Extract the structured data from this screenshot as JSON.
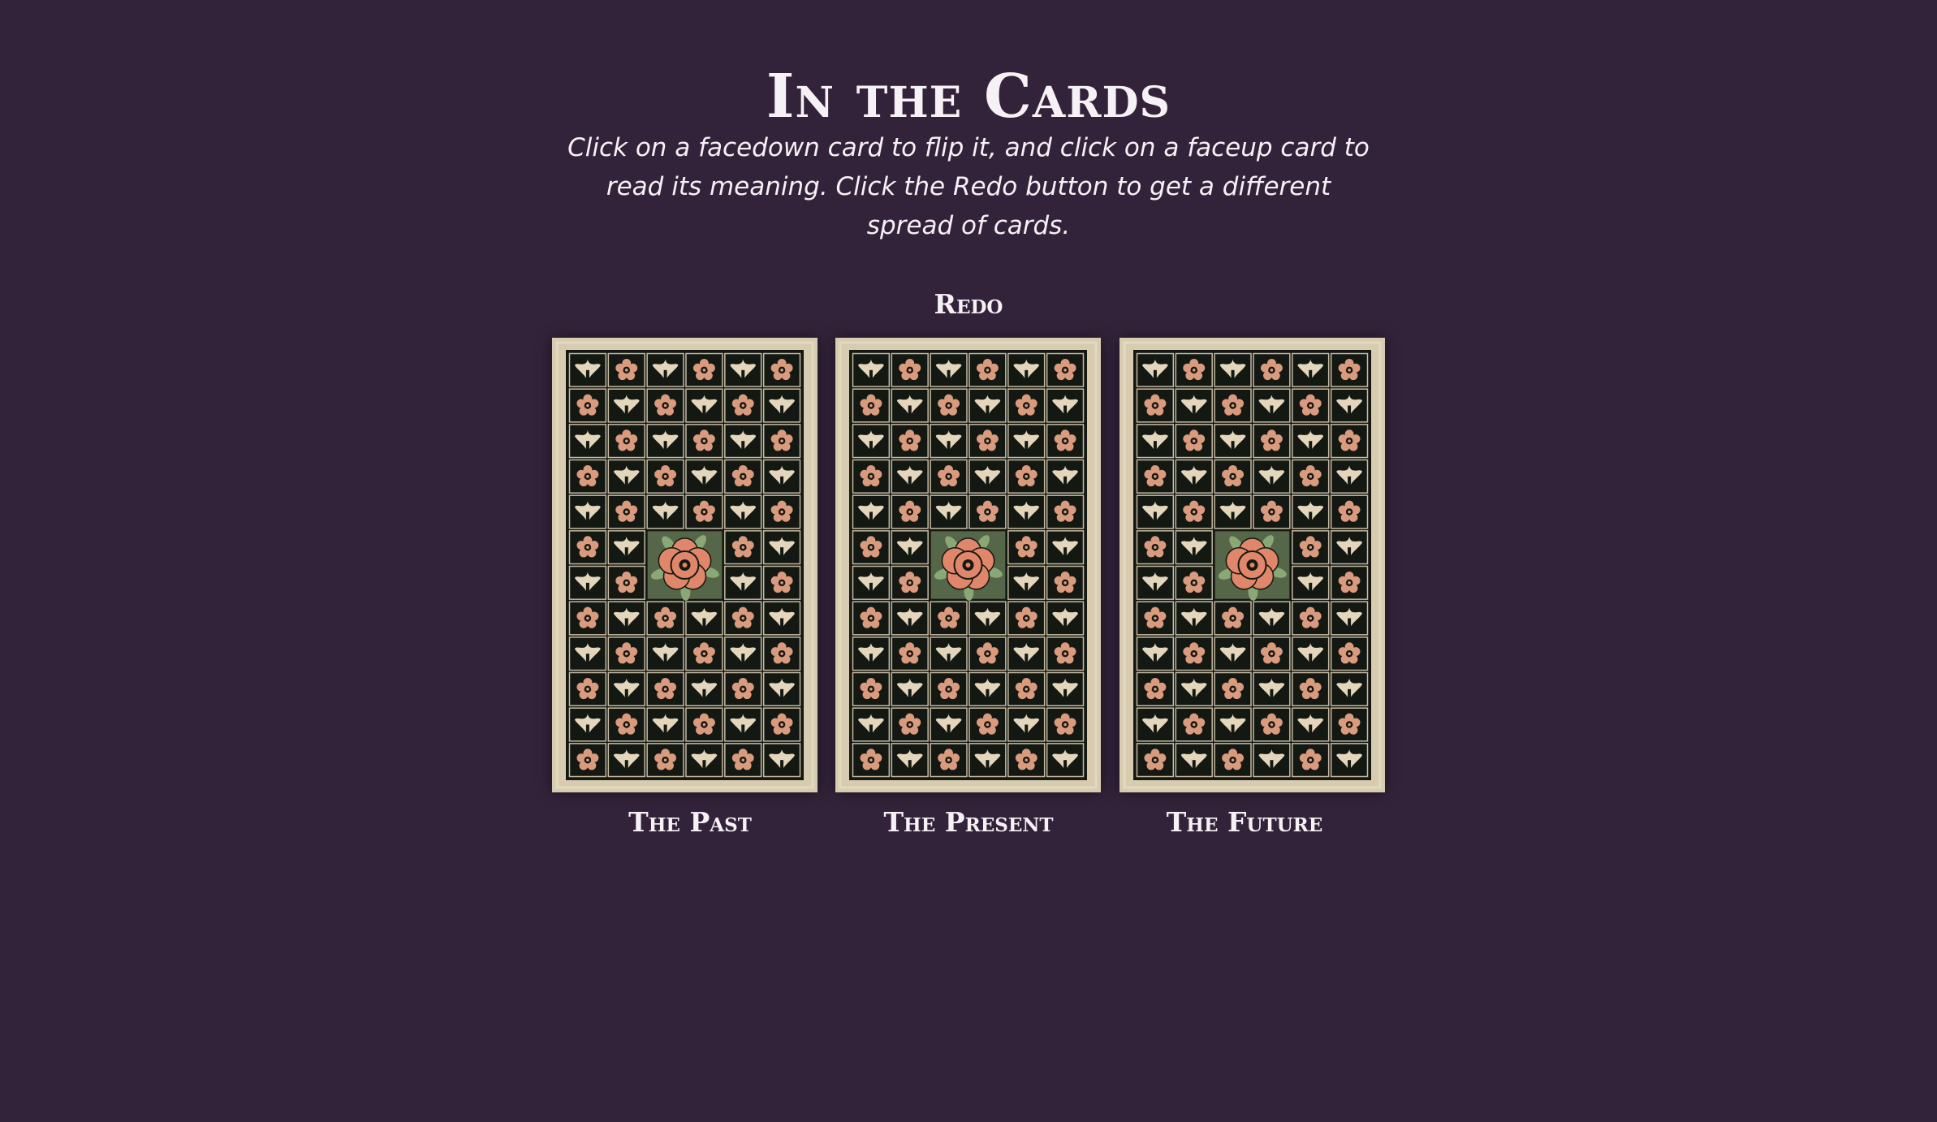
{
  "page": {
    "title": "In the Cards",
    "instructions": "Click on a facedown card to flip it, and click on a faceup card to read its meaning. Click the Redo button to get a different spread of cards.",
    "redo_label": "Redo"
  },
  "cards": [
    {
      "label": "The Past",
      "state": "facedown"
    },
    {
      "label": "The Present",
      "state": "facedown"
    },
    {
      "label": "The Future",
      "state": "facedown"
    }
  ],
  "colors": {
    "background": "#33233a",
    "text": "#f6f1f5",
    "card_border": "#d8ccb0",
    "card_field": "#141812",
    "tile_light": "#e4d6bc",
    "tile_peach": "#d99a7e",
    "rose": "#e0866a",
    "leaf": "#8aa876"
  },
  "icons": {
    "card_back": "tiled-lily-and-rose-pattern",
    "center_emblem": "tudor-rose-icon"
  }
}
